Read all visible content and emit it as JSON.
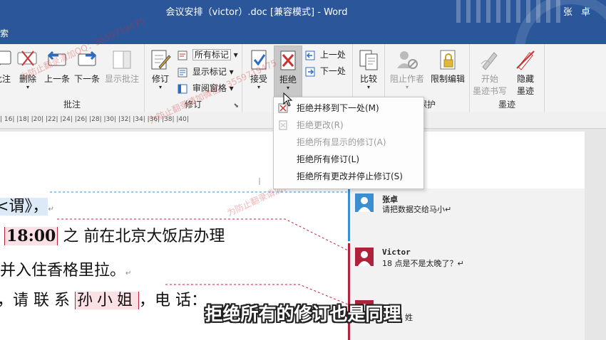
{
  "window": {
    "title": "会议安排（victor）.doc [兼容模式] - Word",
    "user": "张 卓"
  },
  "tellme": {
    "label": "索"
  },
  "ribbon": {
    "comments_group": {
      "label": "批注",
      "new_comment": "批注",
      "delete": "删除",
      "previous": "上一条",
      "next": "下一条",
      "show_comments": "显示批注"
    },
    "tracking_group": {
      "label": "修订",
      "track_changes": "修订",
      "display_for_review": "所有标记",
      "show_markup": "显示标记",
      "reviewing_pane": "审阅窗格"
    },
    "changes_group": {
      "accept": "接受",
      "reject": "拒绝",
      "previous": "上一处",
      "next": "下一处"
    },
    "compare_group": {
      "compare": "比较",
      "compare_arrow": "▾"
    },
    "protect_group": {
      "label": "保护",
      "block_authors": "阻止作者",
      "restrict_editing": "限制编辑"
    },
    "ink_group": {
      "label": "墨迹",
      "start_inking": "开始",
      "start_inking_2": "墨迹书写",
      "hide_ink": "隐藏",
      "hide_ink_2": "墨迹"
    }
  },
  "ruler": {
    "ticks": "| 16| |18| |20| |22| |24| |26| |28| |30| |32| |34| |36| |38| |40|"
  },
  "reject_menu": {
    "items": [
      {
        "label": "拒绝并移到下一处(M)",
        "enabled": true
      },
      {
        "label": "拒绝更改(R)",
        "enabled": false
      },
      {
        "label": "拒绝所有显示的修订(A)",
        "enabled": false
      },
      {
        "label": "拒绝所有修订(L)",
        "enabled": true
      },
      {
        "label": "拒绝所有更改并停止修订(S)",
        "enabled": true
      }
    ]
  },
  "document": {
    "line1": "<谓》，",
    "line2_time": "18:00",
    "line2_rest": " 之  前在北京大饭店办理",
    "line3": " 并入住香格里拉。",
    "line4_pre": "，请 联 系 ",
    "line4_name": "孙小姐",
    "line4_post": "，电 话：",
    "para_mark": "↵"
  },
  "comments": [
    {
      "author": "张卓",
      "text": "请把数据交给马小↵",
      "color": "#3b8fd1"
    },
    {
      "author": "Victor",
      "text": "18 点是不是太晚了？↵",
      "color": "#b0213c"
    },
    {
      "author": "",
      "text": "姓",
      "color": "#b0213c"
    }
  ],
  "watermark": {
    "text1": "为防止翻录清加QQ：3559719475",
    "text2": "为防止翻录请加微信：3559719475"
  },
  "subtitle": "拒绝所有的修订也是同理",
  "colors": {
    "titlebar": "#2b579a",
    "accent_red": "#c0213c",
    "accent_blue": "#3b8fd1"
  }
}
